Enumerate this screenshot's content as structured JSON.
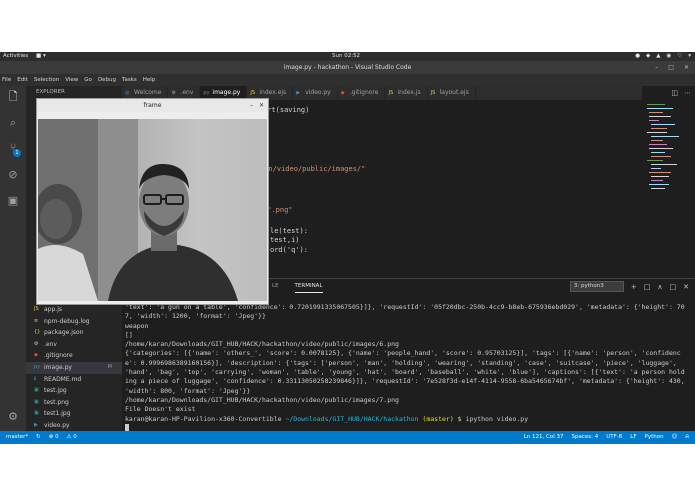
{
  "topbar": {
    "activities": "Activities",
    "app_menu": "■ ▾",
    "clock": "Sun 02:52",
    "tray": [
      "●",
      "◆",
      "▲",
      "◉",
      "♡",
      "▾"
    ]
  },
  "window": {
    "title": "image.py - hackathon - Visual Studio Code",
    "controls": [
      "–",
      "□",
      "✕"
    ]
  },
  "menu": [
    "File",
    "Edit",
    "Selection",
    "View",
    "Go",
    "Debug",
    "Tasks",
    "Help"
  ],
  "sidebar": {
    "header": "EXPLORER",
    "files": [
      {
        "icon": "JS",
        "name": "app.js",
        "status": ""
      },
      {
        "icon": "≡",
        "name": "npm-debug.log",
        "status": ""
      },
      {
        "icon": "{}",
        "name": "package.json",
        "status": ""
      },
      {
        "icon": "⚙",
        "name": ".env",
        "status": ""
      },
      {
        "icon": "◆",
        "name": ".gitignore",
        "status": ""
      },
      {
        "icon": "py",
        "name": "image.py",
        "status": "M"
      },
      {
        "icon": "ℹ",
        "name": "README.md",
        "status": ""
      },
      {
        "icon": "▣",
        "name": "test.jpg",
        "status": ""
      },
      {
        "icon": "▣",
        "name": "test.png",
        "status": ""
      },
      {
        "icon": "▣",
        "name": "test1.jpg",
        "status": ""
      },
      {
        "icon": "▶",
        "name": "video.py",
        "status": ""
      }
    ]
  },
  "tabs": [
    {
      "icon": "◎",
      "label": "Welcome"
    },
    {
      "icon": "⚙",
      "label": ".env"
    },
    {
      "icon": "py",
      "label": "image.py"
    },
    {
      "icon": "JS",
      "label": "index.ejs"
    },
    {
      "icon": "▶",
      "label": "video.py"
    },
    {
      "icon": "◆",
      "label": ".gitignore"
    },
    {
      "icon": "JS",
      "label": "index.js"
    },
    {
      "icon": "JS",
      "label": "layout.ejs"
    }
  ],
  "code": {
    "line1": "ert(saving)",
    "line2": "hon/video/public/images/\"",
    "line3": "+\".png\"",
    "line4": "le(test):",
    "line5": "test,i)",
    "line6": "ord('q'):"
  },
  "panel": {
    "tabs": [
      "LE",
      "TERMINAL"
    ],
    "terminal_select": "3: python3",
    "tools": [
      "+",
      "□",
      "∧",
      "□",
      "✕"
    ]
  },
  "terminal": {
    "l1": "'text': 'a gun on a table', 'confidence': 0.7201991335067505}]}, 'requestId': '05f20dbc-250b-4cc9-b8eb-675936ebd029', 'metadata': {'height': 707, 'width': 1200, 'format': 'Jpeg'}}",
    "l2": "weapon",
    "l3": "[]",
    "l4": "/home/karan/Downloads/GIT_HUB/HACK/hackathon/video/public/images/6.png",
    "l5": "{'categories': [{'name': 'others_', 'score': 0.0078125}, {'name': 'people_hand', 'score': 0.95703125}], 'tags': [{'name': 'person', 'confidence': 0.9996986389160156}], 'description': {'tags': ['person', 'man', 'holding', 'wearing', 'standing', 'case', 'suitcase', 'piece', 'luggage', 'hand', 'bag', 'top', 'carrying', 'woman', 'table', 'young', 'hat', 'board', 'baseball', 'white', 'blue'], 'captions': [{'text': 'a person holding a piece of luggage', 'confidence': 0.33113050258239846}]}, 'requestId': '7e528f3d-e14f-4114-9558-6ba5465674bf', 'metadata': {'height': 430, 'width': 800, 'format': 'Jpeg'}}",
    "l6": "/home/karan/Downloads/GIT_HUB/HACK/hackathon/video/public/images/7.png",
    "l7": "File Doesn't exist",
    "prompt_user": "karan@karan-HP-Pavilion-x360-Convertible",
    "prompt_path": " ~/Downloads/GIT_HUB/HACK/hackathon",
    "prompt_branch": " (master)",
    "prompt_cmd": " $ ipython video.py"
  },
  "frame": {
    "title": "frame",
    "controls": [
      "–",
      "✕"
    ]
  },
  "status": {
    "branch": "master*",
    "sync": "↻",
    "errors": "⊗ 0",
    "warnings": "⚠ 0",
    "position": "Ln 121, Col 37",
    "spaces": "Spaces: 4",
    "encoding": "UTF-8",
    "eol": "LF",
    "language": "Python"
  },
  "colors": {
    "accent": "#007acc",
    "editor_bg": "#1e1e1e",
    "sidebar_bg": "#252526",
    "activity_bg": "#333333"
  }
}
